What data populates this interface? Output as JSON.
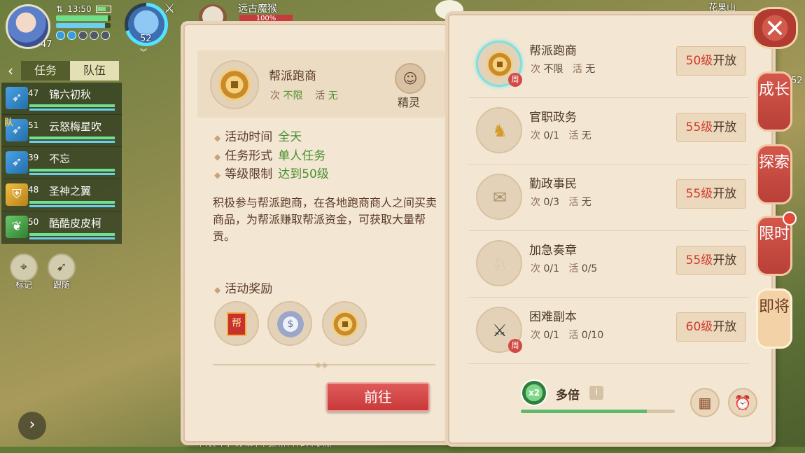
{
  "hud": {
    "player_level": "47",
    "time": "13:50",
    "hp_fill": 0.95,
    "mp_fill": 0.9,
    "pet_level": "52",
    "target_name": "远古魔猴",
    "target_hp": "100%",
    "map_name": "花果山",
    "edge_number": "52"
  },
  "team": {
    "tabs": [
      {
        "label": "任务",
        "active": false
      },
      {
        "label": "队伍",
        "active": true
      }
    ],
    "members": [
      {
        "level": "47",
        "name": "锦六初秋",
        "icon": "sword-class-icon",
        "leader": false
      },
      {
        "level": "51",
        "name": "云怒梅星吹",
        "icon": "sword-class-icon",
        "leader": true,
        "leader_mark": "队"
      },
      {
        "level": "39",
        "name": "不忘",
        "icon": "sword-class-icon",
        "leader": false
      },
      {
        "level": "48",
        "name": "圣神之翼",
        "icon": "shield-class-icon",
        "leader": false
      },
      {
        "level": "50",
        "name": "酷酷皮皮柯",
        "icon": "leaf-class-icon",
        "leader": false
      }
    ],
    "buttons": [
      {
        "label": "标记",
        "icon": "map-pin-icon"
      },
      {
        "label": "跟随",
        "icon": "follow-icon"
      }
    ]
  },
  "chat": {
    "line": "古妖王，获得1个玩资丹作为奖励！"
  },
  "detail": {
    "title": "帮派跑商",
    "times_label": "次",
    "times_value": "不限",
    "active_label": "活",
    "active_value": "无",
    "spirit_label": "精灵",
    "info": [
      {
        "label": "活动时间",
        "value": "全天"
      },
      {
        "label": "任务形式",
        "value": "单人任务"
      },
      {
        "label": "等级限制",
        "value": "达到50级"
      }
    ],
    "description": "积极参与帮派跑商，在各地跑商商人之间买卖商品，为帮派赚取帮派资金，可获取大量帮贡。",
    "reward_title": "活动奖励",
    "reward_flag_text": "帮",
    "rewards": [
      "guild-contribution-flag-icon",
      "silver-coin-icon",
      "gold-coin-icon"
    ],
    "go_button": "前往"
  },
  "activities": [
    {
      "name": "帮派跑商",
      "times": "不限",
      "active": "无",
      "open_level": "50级",
      "open_suffix": "开放",
      "icon": "gold-coin-icon",
      "weekly": "周",
      "selected": true
    },
    {
      "name": "官职政务",
      "times": "0/1",
      "active": "无",
      "open_level": "55级",
      "open_suffix": "开放",
      "icon": "golden-qilin-icon",
      "weekly": "",
      "selected": false
    },
    {
      "name": "勤政事民",
      "times": "0/3",
      "active": "无",
      "open_level": "55级",
      "open_suffix": "开放",
      "icon": "scroll-letters-icon",
      "weekly": "",
      "selected": false
    },
    {
      "name": "加急奏章",
      "times": "0/1",
      "active": "0/5",
      "open_level": "55级",
      "open_suffix": "开放",
      "icon": "jade-horse-icon",
      "weekly": "",
      "selected": false
    },
    {
      "name": "困难副本",
      "times": "0/1",
      "active": "0/10",
      "open_level": "60级",
      "open_suffix": "开放",
      "icon": "dark-blade-icon",
      "weekly": "周",
      "selected": false
    }
  ],
  "activity_labels": {
    "times": "次",
    "active": "活"
  },
  "multiplier": {
    "badge": "x2",
    "label": "多倍",
    "info": "i",
    "fill": 0.82
  },
  "side_tabs": [
    {
      "label": "成长",
      "active": false
    },
    {
      "label": "探索",
      "active": false
    },
    {
      "label": "限时",
      "active": false,
      "red_dot": true
    },
    {
      "label": "即将",
      "active": true
    }
  ],
  "close_label": "✕"
}
